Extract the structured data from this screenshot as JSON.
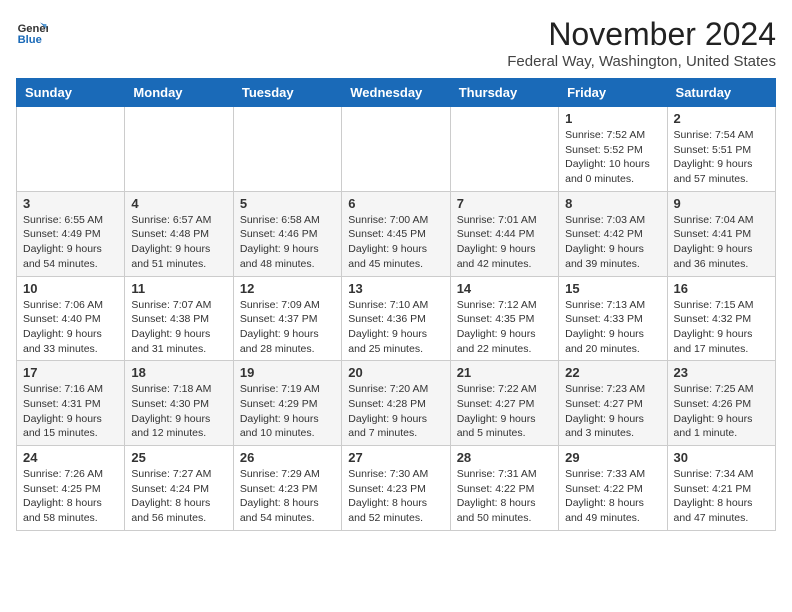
{
  "header": {
    "logo": {
      "general": "General",
      "blue": "Blue"
    },
    "month_year": "November 2024",
    "location": "Federal Way, Washington, United States"
  },
  "weekdays": [
    "Sunday",
    "Monday",
    "Tuesday",
    "Wednesday",
    "Thursday",
    "Friday",
    "Saturday"
  ],
  "weeks": [
    [
      {
        "day": "",
        "info": ""
      },
      {
        "day": "",
        "info": ""
      },
      {
        "day": "",
        "info": ""
      },
      {
        "day": "",
        "info": ""
      },
      {
        "day": "",
        "info": ""
      },
      {
        "day": "1",
        "info": "Sunrise: 7:52 AM\nSunset: 5:52 PM\nDaylight: 10 hours\nand 0 minutes."
      },
      {
        "day": "2",
        "info": "Sunrise: 7:54 AM\nSunset: 5:51 PM\nDaylight: 9 hours\nand 57 minutes."
      }
    ],
    [
      {
        "day": "3",
        "info": "Sunrise: 6:55 AM\nSunset: 4:49 PM\nDaylight: 9 hours\nand 54 minutes."
      },
      {
        "day": "4",
        "info": "Sunrise: 6:57 AM\nSunset: 4:48 PM\nDaylight: 9 hours\nand 51 minutes."
      },
      {
        "day": "5",
        "info": "Sunrise: 6:58 AM\nSunset: 4:46 PM\nDaylight: 9 hours\nand 48 minutes."
      },
      {
        "day": "6",
        "info": "Sunrise: 7:00 AM\nSunset: 4:45 PM\nDaylight: 9 hours\nand 45 minutes."
      },
      {
        "day": "7",
        "info": "Sunrise: 7:01 AM\nSunset: 4:44 PM\nDaylight: 9 hours\nand 42 minutes."
      },
      {
        "day": "8",
        "info": "Sunrise: 7:03 AM\nSunset: 4:42 PM\nDaylight: 9 hours\nand 39 minutes."
      },
      {
        "day": "9",
        "info": "Sunrise: 7:04 AM\nSunset: 4:41 PM\nDaylight: 9 hours\nand 36 minutes."
      }
    ],
    [
      {
        "day": "10",
        "info": "Sunrise: 7:06 AM\nSunset: 4:40 PM\nDaylight: 9 hours\nand 33 minutes."
      },
      {
        "day": "11",
        "info": "Sunrise: 7:07 AM\nSunset: 4:38 PM\nDaylight: 9 hours\nand 31 minutes."
      },
      {
        "day": "12",
        "info": "Sunrise: 7:09 AM\nSunset: 4:37 PM\nDaylight: 9 hours\nand 28 minutes."
      },
      {
        "day": "13",
        "info": "Sunrise: 7:10 AM\nSunset: 4:36 PM\nDaylight: 9 hours\nand 25 minutes."
      },
      {
        "day": "14",
        "info": "Sunrise: 7:12 AM\nSunset: 4:35 PM\nDaylight: 9 hours\nand 22 minutes."
      },
      {
        "day": "15",
        "info": "Sunrise: 7:13 AM\nSunset: 4:33 PM\nDaylight: 9 hours\nand 20 minutes."
      },
      {
        "day": "16",
        "info": "Sunrise: 7:15 AM\nSunset: 4:32 PM\nDaylight: 9 hours\nand 17 minutes."
      }
    ],
    [
      {
        "day": "17",
        "info": "Sunrise: 7:16 AM\nSunset: 4:31 PM\nDaylight: 9 hours\nand 15 minutes."
      },
      {
        "day": "18",
        "info": "Sunrise: 7:18 AM\nSunset: 4:30 PM\nDaylight: 9 hours\nand 12 minutes."
      },
      {
        "day": "19",
        "info": "Sunrise: 7:19 AM\nSunset: 4:29 PM\nDaylight: 9 hours\nand 10 minutes."
      },
      {
        "day": "20",
        "info": "Sunrise: 7:20 AM\nSunset: 4:28 PM\nDaylight: 9 hours\nand 7 minutes."
      },
      {
        "day": "21",
        "info": "Sunrise: 7:22 AM\nSunset: 4:27 PM\nDaylight: 9 hours\nand 5 minutes."
      },
      {
        "day": "22",
        "info": "Sunrise: 7:23 AM\nSunset: 4:27 PM\nDaylight: 9 hours\nand 3 minutes."
      },
      {
        "day": "23",
        "info": "Sunrise: 7:25 AM\nSunset: 4:26 PM\nDaylight: 9 hours\nand 1 minute."
      }
    ],
    [
      {
        "day": "24",
        "info": "Sunrise: 7:26 AM\nSunset: 4:25 PM\nDaylight: 8 hours\nand 58 minutes."
      },
      {
        "day": "25",
        "info": "Sunrise: 7:27 AM\nSunset: 4:24 PM\nDaylight: 8 hours\nand 56 minutes."
      },
      {
        "day": "26",
        "info": "Sunrise: 7:29 AM\nSunset: 4:23 PM\nDaylight: 8 hours\nand 54 minutes."
      },
      {
        "day": "27",
        "info": "Sunrise: 7:30 AM\nSunset: 4:23 PM\nDaylight: 8 hours\nand 52 minutes."
      },
      {
        "day": "28",
        "info": "Sunrise: 7:31 AM\nSunset: 4:22 PM\nDaylight: 8 hours\nand 50 minutes."
      },
      {
        "day": "29",
        "info": "Sunrise: 7:33 AM\nSunset: 4:22 PM\nDaylight: 8 hours\nand 49 minutes."
      },
      {
        "day": "30",
        "info": "Sunrise: 7:34 AM\nSunset: 4:21 PM\nDaylight: 8 hours\nand 47 minutes."
      }
    ]
  ]
}
